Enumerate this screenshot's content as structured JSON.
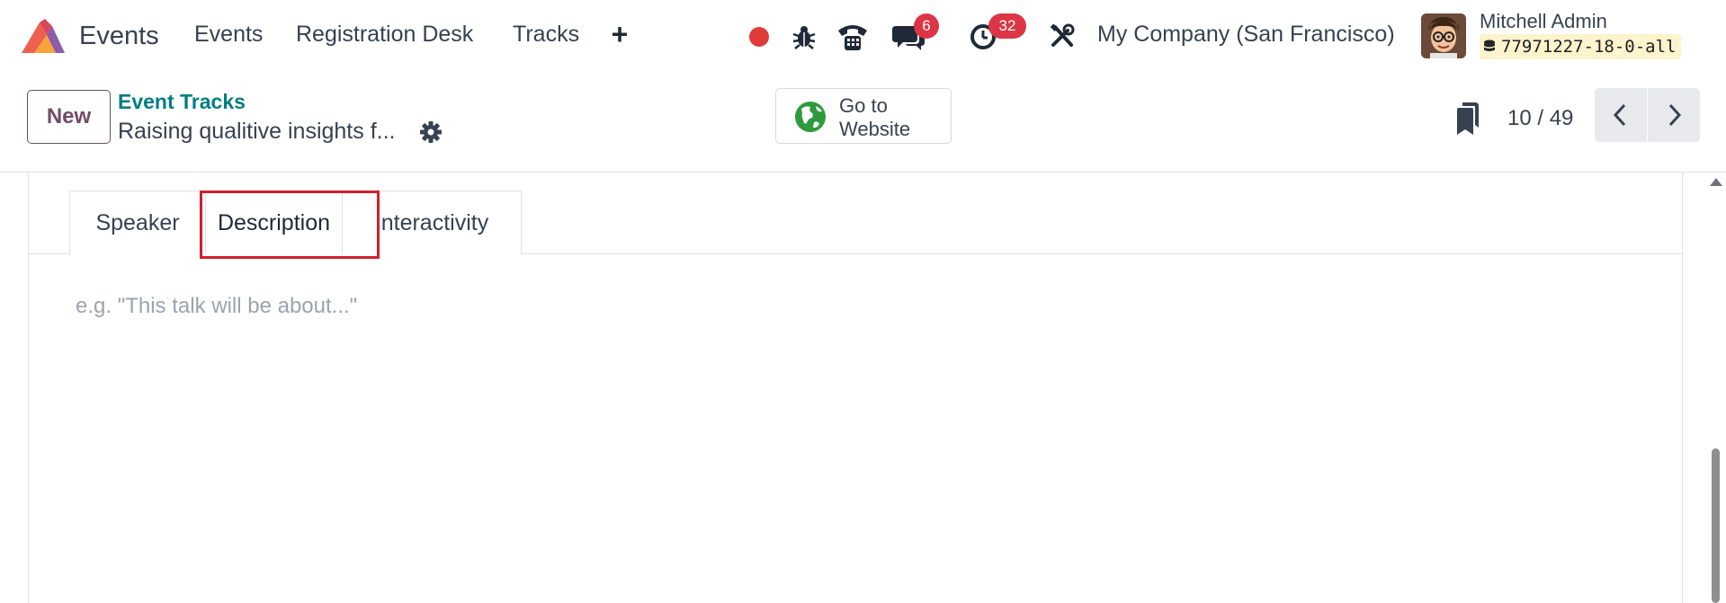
{
  "navbar": {
    "app_name": "Events",
    "menu": [
      "Events",
      "Registration Desk",
      "Tracks"
    ],
    "add_icon": "plus-icon",
    "icons": [
      "record-icon",
      "bug-icon",
      "phone-icon",
      "chat-icon",
      "activity-clock-icon",
      "tools-icon"
    ],
    "messages_count": "6",
    "activities_count": "32",
    "company": "My Company (San Francisco)",
    "user_name": "Mitchell Admin",
    "database": "77971227-18-0-all"
  },
  "control_panel": {
    "new_label": "New",
    "breadcrumb_parent": "Event Tracks",
    "record_title": "Raising qualitive insights f...",
    "website_button_label": "Go to Website",
    "pager_value": "10 / 49"
  },
  "form": {
    "tabs": [
      "Speaker",
      "Description",
      "Interactivity"
    ],
    "active_tab": "Description",
    "description_placeholder": "e.g. \"This talk will be about...\""
  },
  "colors": {
    "brand_purple": "#714b67",
    "breadcrumb_teal": "#017e84",
    "badge_red": "#dc3545",
    "highlight_red": "#d0202b",
    "record_red": "#e03a3a",
    "globe_green": "#2e9a3e"
  }
}
